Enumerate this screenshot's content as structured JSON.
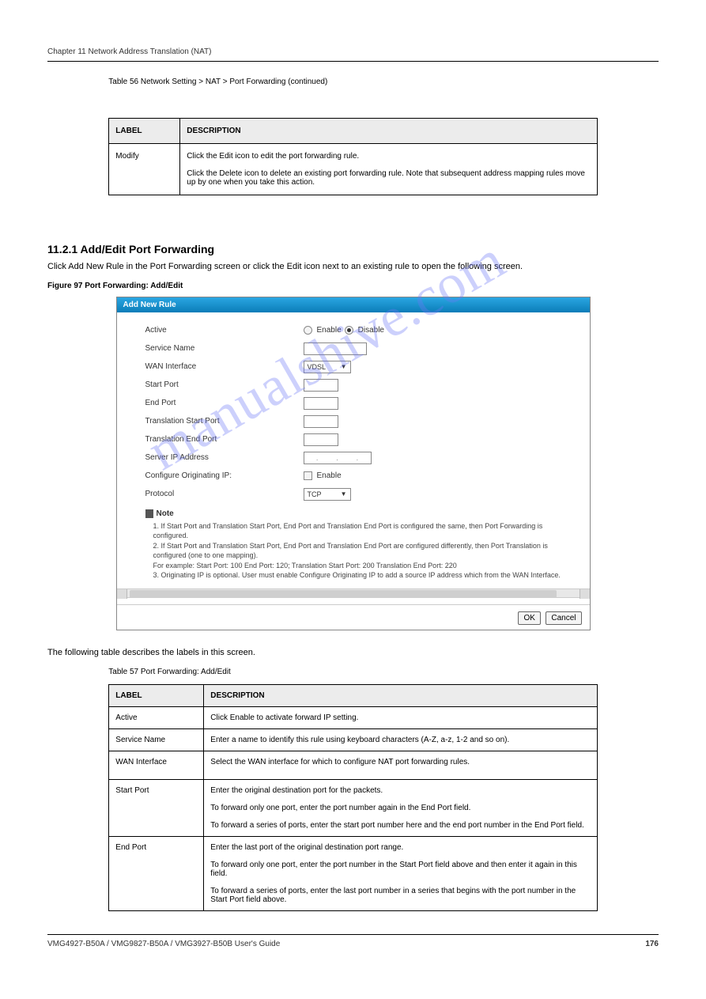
{
  "chapter": {
    "title": "Chapter 11 Network Address Translation (NAT)",
    "num": "11"
  },
  "table1": {
    "caption": "Table 56   Network Setting > NAT > Port Forwarding (continued)",
    "headers": {
      "label": "LABEL",
      "desc": "DESCRIPTION"
    },
    "rows": [
      {
        "label": "Modify",
        "desc": "Click the Edit icon to edit the port forwarding rule.\n\nClick the Delete icon to delete an existing port forwarding rule. Note that subsequent address mapping rules move up by one when you take this action."
      }
    ]
  },
  "section": {
    "num": "11.2.1   Add/Edit Port Forwarding",
    "text": "Click Add New Rule in the Port Forwarding screen or click the Edit icon next to an existing rule to open the following screen."
  },
  "figcaption": "Figure 97   Port Forwarding: Add/Edit",
  "dialog": {
    "title": "Add New Rule",
    "labels": {
      "active": "Active",
      "service": "Service Name",
      "wan": "WAN Interface",
      "startport": "Start Port",
      "endport": "End Port",
      "tstart": "Translation Start Port",
      "tend": "Translation End Port",
      "serverip": "Server IP Address",
      "origip": "Configure Originating IP:",
      "protocol": "Protocol"
    },
    "radio": {
      "enable": "Enable",
      "disable": "Disable"
    },
    "wan_value": "VDSL",
    "enable_chk": "Enable",
    "protocol_value": "TCP",
    "note_label": "Note",
    "notes": [
      "1.  If Start Port and Translation Start Port, End Port and Translation End Port is configured the same, then Port Forwarding is configured.",
      "2.  If Start Port and Translation Start Port, End Port and Translation End Port are configured differently, then Port Translation is configured (one to one mapping).",
      "     For example: Start Port: 100 End Port: 120; Translation Start Port: 200 Translation End Port: 220",
      "3.  Originating IP is optional. User must enable Configure Originating IP to add a source IP address which from the WAN Interface."
    ],
    "buttons": {
      "ok": "OK",
      "cancel": "Cancel"
    }
  },
  "table2": {
    "caption_intro": "The following table describes the labels in this screen.",
    "caption": "Table 57   Port Forwarding: Add/Edit",
    "headers": {
      "label": "LABEL",
      "desc": "DESCRIPTION"
    },
    "rows": [
      {
        "label": "Active",
        "desc": "Click Enable to activate forward IP setting."
      },
      {
        "label": "Service Name",
        "desc": "Enter a name to identify this rule using keyboard characters (A-Z, a-z, 1-2 and so on)."
      },
      {
        "label": "WAN Interface",
        "desc": "Select the WAN interface for which to configure NAT port forwarding rules."
      },
      {
        "label": "Start Port",
        "desc": "Enter the original destination port for the packets.\n\nTo forward only one port, enter the port number again in the End Port field.\n\nTo forward a series of ports, enter the start port number here and the end port number in the End Port field."
      },
      {
        "label": "End Port",
        "desc": "Enter the last port of the original destination port range.\n\nTo forward only one port, enter the port number in the Start Port field above and then enter it again in this field.\n\nTo forward a series of ports, enter the last port number in a series that begins with the port number in the Start Port field above."
      }
    ]
  },
  "footer": {
    "book": "VMG4927-B50A / VMG9827-B50A / VMG3927-B50B User's Guide",
    "page": "176"
  }
}
